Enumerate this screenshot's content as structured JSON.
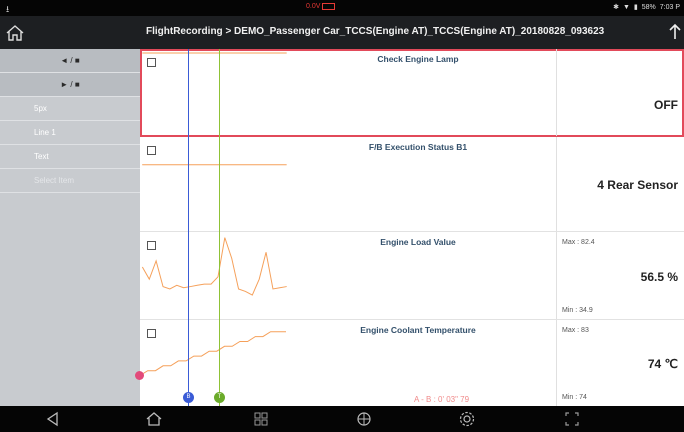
{
  "status_bar": {
    "usb_icon": "usb-icon",
    "voltage": "0.0V",
    "battery_icon": "car-battery-icon",
    "bt_icon": "bluetooth-icon",
    "wifi_icon": "wifi-icon",
    "battery_percent": "58%",
    "time": "7:03 P"
  },
  "title_bar": {
    "home_icon": "home-icon",
    "title": "FlightRecording > DEMO_Passenger Car_TCCS(Engine AT)_TCCS(Engine AT)_20180828_093623",
    "upload_icon": "upload-icon"
  },
  "sidebar": {
    "items": [
      {
        "label": "◄ / ■"
      },
      {
        "label": "► / ■"
      },
      {
        "label": "5px"
      },
      {
        "label": "Line 1"
      },
      {
        "label": "Text"
      },
      {
        "label": "Select Item"
      }
    ]
  },
  "rows": [
    {
      "name": "Check Engine Lamp",
      "value": "OFF",
      "max": "",
      "min": ""
    },
    {
      "name": "F/B Execution Status B1",
      "value": "4 Rear Sensor",
      "max": "",
      "min": ""
    },
    {
      "name": "Engine Load Value",
      "value": "56.5 %",
      "max": "Max :  82.4",
      "min": "Min :  34.9"
    },
    {
      "name": "Engine Coolant Temperature",
      "value": "74 ℃",
      "max": "Max :   83",
      "min": "Min :   74"
    }
  ],
  "cursors": {
    "a_label": "B",
    "b_label": "T",
    "ab_readout": "A - B : 0' 03\" 79"
  },
  "colors": {
    "accent_red": "#e24a5a",
    "graph_orange": "#f5a05a",
    "cursor_blue": "#3a5bd6",
    "cursor_green": "#8fc236",
    "header_bg": "#1d1f22",
    "sidebar_bg": "#c8cbcf"
  },
  "chart_data": [
    {
      "type": "line",
      "title": "Engine Load Value",
      "series": [
        {
          "values": [
            58,
            48,
            63,
            42,
            40,
            43,
            41,
            42,
            43,
            44,
            44,
            50,
            82,
            65,
            40,
            38,
            35,
            48,
            70,
            40,
            41,
            42
          ]
        }
      ]
    },
    {
      "type": "line",
      "title": "Engine Coolant Temperature",
      "series": [
        {
          "values": [
            74,
            75,
            75,
            76,
            76,
            77,
            77,
            78,
            78,
            79,
            79,
            80,
            80,
            81,
            81,
            82,
            82,
            83,
            83,
            83
          ]
        }
      ]
    }
  ],
  "nav_bar": {
    "back_icon": "back-icon",
    "home_icon": "home-icon",
    "apps_icon": "apps-grid-icon",
    "browser_icon": "globe-icon",
    "settings_icon": "gear-icon",
    "screenshot_icon": "screenshot-icon"
  }
}
